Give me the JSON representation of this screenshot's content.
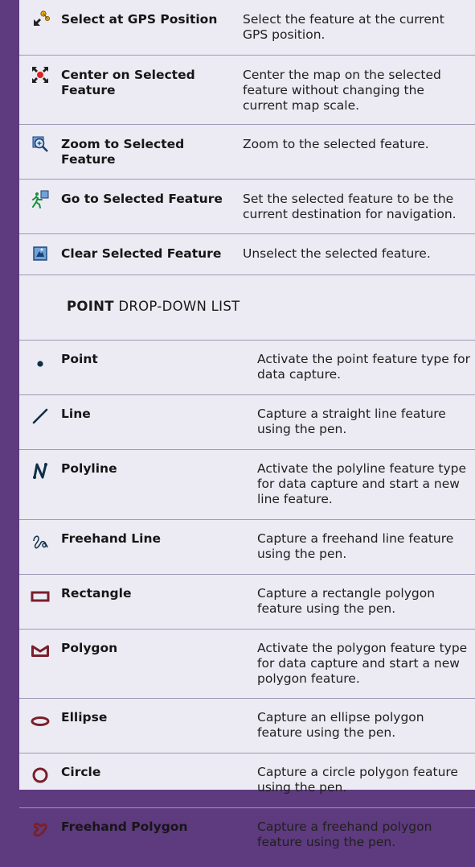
{
  "section1": {
    "rows": [
      {
        "icon": "select-gps-icon",
        "name": "Select at GPS Position",
        "desc": "Select the feature at the current GPS position."
      },
      {
        "icon": "center-selected-icon",
        "name": "Center on Selected Feature",
        "desc": "Center the map on the selected feature without changing the current map scale."
      },
      {
        "icon": "zoom-selected-icon",
        "name": "Zoom to Selected Feature",
        "desc": "Zoom to the selected feature."
      },
      {
        "icon": "goto-selected-icon",
        "name": "Go to Selected Feature",
        "desc": "Set the selected feature to be the current destination for navigation."
      },
      {
        "icon": "clear-selected-icon",
        "name": "Clear Selected Feature",
        "desc": "Unselect the selected feature."
      }
    ]
  },
  "section2": {
    "heading_bold": "POINT",
    "heading_rest": " DROP-DOWN LIST",
    "rows": [
      {
        "icon": "point-icon",
        "name": "Point",
        "desc": "Activate the point feature type for data capture."
      },
      {
        "icon": "line-icon",
        "name": "Line",
        "desc": "Capture a straight line feature using the pen."
      },
      {
        "icon": "polyline-icon",
        "name": "Polyline",
        "desc": "Activate the polyline feature type for data capture and start a new line feature."
      },
      {
        "icon": "freehand-line-icon",
        "name": "Freehand Line",
        "desc": "Capture a freehand line feature using the pen."
      },
      {
        "icon": "rectangle-icon",
        "name": "Rectangle",
        "desc": "Capture a rectangle polygon feature using the pen."
      },
      {
        "icon": "polygon-icon",
        "name": "Polygon",
        "desc": "Activate the polygon feature type for data capture and start a new polygon feature."
      },
      {
        "icon": "ellipse-icon",
        "name": "Ellipse",
        "desc": "Capture an ellipse polygon feature using the pen."
      },
      {
        "icon": "circle-icon",
        "name": "Circle",
        "desc": "Capture a circle polygon feature using the pen."
      },
      {
        "icon": "freehand-polygon-icon",
        "name": "Freehand Polygon",
        "desc": "Capture a freehand polygon feature using the pen."
      }
    ]
  }
}
